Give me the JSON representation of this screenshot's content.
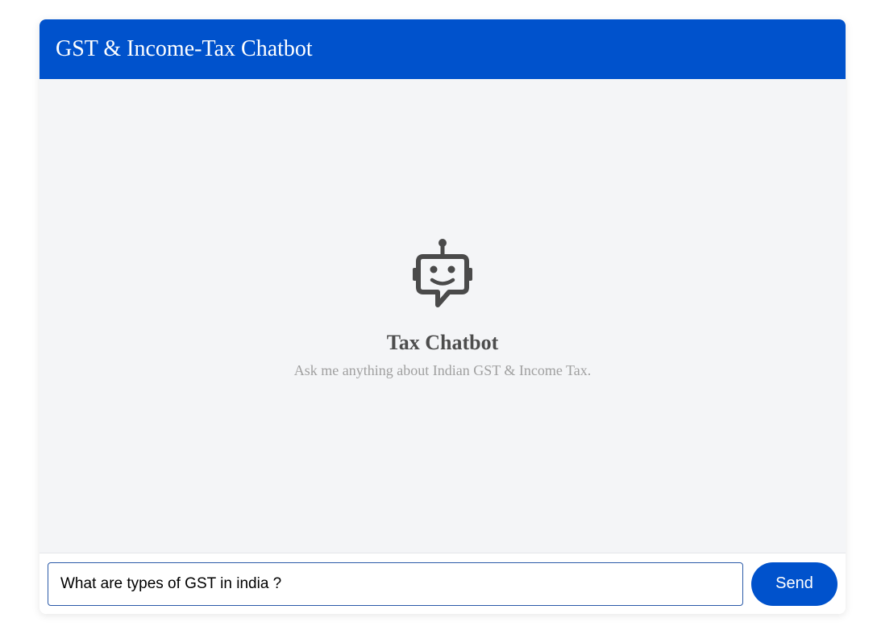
{
  "header": {
    "title": "GST & Income-Tax Chatbot"
  },
  "empty_state": {
    "icon": "robot-chat-icon",
    "title": "Tax Chatbot",
    "subtitle": "Ask me anything about Indian GST & Income Tax."
  },
  "composer": {
    "input_value": "What are types of GST in india ?",
    "send_label": "Send"
  },
  "colors": {
    "brand": "#0052cc",
    "body_background": "#f4f5f7",
    "icon": "#4a4a4a",
    "title_text": "#4d4d4d",
    "subtitle_text": "#a0a0a0"
  }
}
